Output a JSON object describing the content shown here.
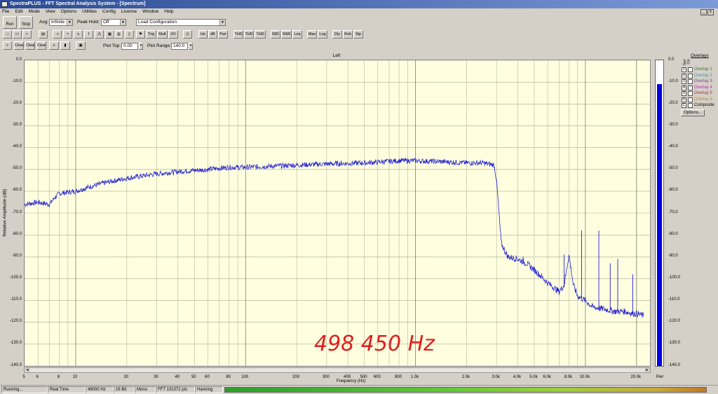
{
  "window": {
    "title": "SpectraPLUS - FFT Spectral Analysis System - [Spectrum]"
  },
  "menu": [
    "File",
    "Edit",
    "Mode",
    "View",
    "Options",
    "Utilities",
    "Config",
    "License",
    "Window",
    "Help"
  ],
  "toolbar1": {
    "run_label": "Run",
    "stop_label": "Stop",
    "avg_label": "Avg:",
    "avg_value": "Infinite",
    "peak_hold_label": "Peak Hold:",
    "peak_hold_value": "Off",
    "config_value": "Load Configuration"
  },
  "toolbar2": {
    "buttons": [
      "Hz",
      "dB",
      "Pwr",
      "THD",
      "THD +N",
      "THD Freq",
      "IMD",
      "SNR",
      "Leq",
      "Mas",
      "Log",
      "Dty",
      "Rvb",
      "Stp",
      "Trig",
      "Mult",
      "I/O"
    ]
  },
  "toolbar3": {
    "buttons": [
      "Clear All",
      "Clear Max",
      "Clear Min"
    ],
    "plot_top_label": "Plot Top:",
    "plot_top_value": "0.00",
    "plot_range_label": "Plot Range:",
    "plot_range_value": "140.0"
  },
  "panel": {
    "title": "Left"
  },
  "chart_data": {
    "type": "line",
    "title": "Left",
    "xlabel": "Frequency (Hz)",
    "ylabel": "Relative Amplitude (dB)",
    "x_scale": "log",
    "xlim": [
      5,
      24000
    ],
    "ylim": [
      -140,
      0
    ],
    "grid": true,
    "y_ticks": [
      "0.0",
      "-10.0",
      "-20.0",
      "-30.0",
      "-40.0",
      "-50.0",
      "-60.0",
      "-70.0",
      "-80.0",
      "-90.0",
      "-100.0",
      "-110.0",
      "-120.0",
      "-130.0",
      "-140.0"
    ],
    "x_ticks": [
      "5",
      "6",
      "8",
      "10",
      "20",
      "30",
      "40",
      "50",
      "60",
      "80",
      "100",
      "200",
      "300",
      "400",
      "500",
      "600",
      "800",
      "1.0k",
      "2.0k",
      "3.0k",
      "4.0k",
      "5.0k",
      "6.0k",
      "8.0k",
      "10.0k",
      "20.0k"
    ],
    "series": [
      {
        "name": "Left",
        "color": "#2020d0",
        "x": [
          5,
          6,
          7,
          7.5,
          8,
          10,
          12,
          15,
          20,
          30,
          40,
          60,
          80,
          100,
          200,
          300,
          500,
          800,
          1000,
          1500,
          2000,
          2500,
          2900,
          3000,
          3100,
          3200,
          3500,
          4000,
          4500,
          5000,
          5500,
          6000,
          6500,
          7000,
          7500,
          8000,
          8500,
          9000,
          10000,
          11000,
          13000,
          15000,
          17000,
          19000,
          20000,
          22000
        ],
        "y": [
          -66,
          -65,
          -66,
          -63,
          -61,
          -60,
          -58,
          -56,
          -54,
          -52,
          -51,
          -50,
          -49,
          -49,
          -48,
          -47.5,
          -47,
          -46,
          -46,
          -46.5,
          -47,
          -47,
          -48,
          -55,
          -70,
          -84,
          -90,
          -91,
          -93,
          -96,
          -99,
          -102,
          -104,
          -106,
          -103,
          -89,
          -103,
          -108,
          -110,
          -113,
          -114,
          -115,
          -115,
          -116,
          -116,
          -117
        ]
      }
    ],
    "peaks_hz": [
      4300,
      7500,
      9500,
      12000,
      14000,
      15500,
      19000
    ],
    "meter": {
      "label": "Pwr",
      "level_db": -11,
      "ticks": [
        "0.0",
        "-10.0",
        "-20.0",
        "-30.0",
        "-40.0",
        "-50.0",
        "-60.0",
        "-70.0",
        "-80.0",
        "-90.0",
        "-100.0",
        "-110.0",
        "-120.0",
        "-130.0",
        "-140.0"
      ]
    }
  },
  "overlays": {
    "title": "Overlays",
    "set_label": "Set",
    "on_label": "On",
    "items": [
      {
        "num": "1",
        "label": "Overlay 1",
        "color": "#3a7a3a"
      },
      {
        "num": "2",
        "label": "Overlay 2",
        "color": "#3a9ab0"
      },
      {
        "num": "3",
        "label": "Overlay 3",
        "color": "#8a3a8a"
      },
      {
        "num": "4",
        "label": "Overlay 4",
        "color": "#d020d0"
      },
      {
        "num": "5",
        "label": "Overlay 5",
        "color": "#a03a3a"
      },
      {
        "num": "6",
        "label": "Overlay 6",
        "color": "#c08a3a"
      },
      {
        "num": "C",
        "label": "Composite",
        "color": "#000000"
      }
    ],
    "options_label": "Options..."
  },
  "status": {
    "state": "Running...",
    "mode": "Real Time",
    "sample_rate": "48000 Hz",
    "bits": "16 Bit",
    "channels": "Mono",
    "fft": "FFT 131072 pts",
    "window": "Hanning"
  },
  "annotation": "498 450 Hz"
}
